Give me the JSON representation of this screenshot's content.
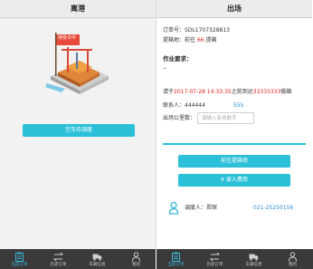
{
  "left": {
    "title": "离港",
    "empty_button": "空车待调度",
    "flag_text": "待受令中"
  },
  "right": {
    "title": "出场",
    "order_label": "订单号：",
    "order_no": "SDL1707328813",
    "pickup_label": "提箱地：",
    "pickup_prefix": "前往",
    "pickup_num": "66",
    "pickup_suffix": "提箱",
    "req_label": "作业要求：",
    "req_value": "--",
    "deadline_prefix": "请于",
    "deadline_time": "2017-07-28 14:33:35",
    "deadline_mid": "之前到达",
    "deadline_place": "33333333",
    "deadline_suffix": "做箱",
    "contact_label": "联系人：",
    "contact_name": "444444",
    "contact_phone": "555",
    "mileage_label": "出场公里数：",
    "mileage_placeholder": "请输入有效数字",
    "btn_go": "前往提箱地",
    "btn_fee": "¥  录入费用",
    "dispatcher_label": "调度人：",
    "dispatcher_name": "郑琛",
    "dispatcher_phone": "021-25250156"
  },
  "tabs": [
    {
      "label": "当前订单",
      "icon": "clipboard-icon"
    },
    {
      "label": "历史订单",
      "icon": "history-icon"
    },
    {
      "label": "车辆信息",
      "icon": "truck-icon"
    },
    {
      "label": "我的",
      "icon": "person-icon"
    }
  ],
  "colors": {
    "accent": "#2bc0d8",
    "red": "#e02020",
    "tabbar": "#3a3a3a",
    "active_tab": "#37b7d5"
  }
}
